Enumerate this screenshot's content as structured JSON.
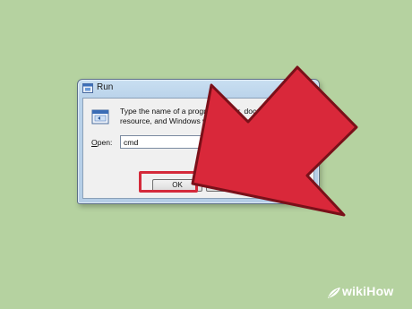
{
  "dialog": {
    "title": "Run",
    "description_line1": "Type the name of a program, folder, docum",
    "description_line2": "resource, and Windows will open it for yo",
    "open_label_mnemonic": "O",
    "open_label_rest": "pen:",
    "open_value": "cmd",
    "ok_label": "OK",
    "cancel_label": "",
    "browse_label": ""
  },
  "highlight_color": "#d42a3a",
  "arrow_color": "#d9283a",
  "background_color": "#b5d2a0",
  "watermark": {
    "text": "wikiHow",
    "icon": "wikihow-leaf-icon"
  }
}
